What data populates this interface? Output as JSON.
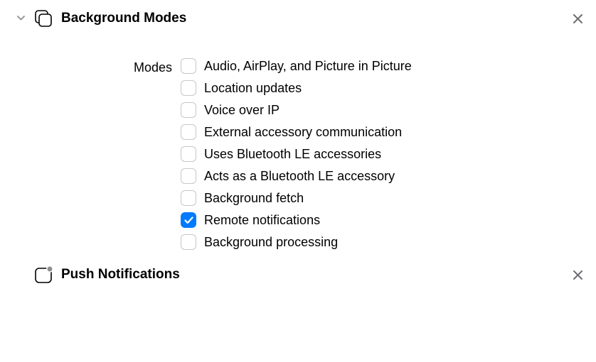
{
  "capabilities": [
    {
      "title": "Background Modes",
      "icon": "background-modes-icon",
      "expanded": true,
      "fields": {
        "label": "Modes",
        "options": [
          {
            "label": "Audio, AirPlay, and Picture in Picture",
            "checked": false
          },
          {
            "label": "Location updates",
            "checked": false
          },
          {
            "label": "Voice over IP",
            "checked": false
          },
          {
            "label": "External accessory communication",
            "checked": false
          },
          {
            "label": "Uses Bluetooth LE accessories",
            "checked": false
          },
          {
            "label": "Acts as a Bluetooth LE accessory",
            "checked": false
          },
          {
            "label": "Background fetch",
            "checked": false
          },
          {
            "label": "Remote notifications",
            "checked": true
          },
          {
            "label": "Background processing",
            "checked": false
          }
        ]
      }
    },
    {
      "title": "Push Notifications",
      "icon": "push-notifications-icon",
      "expanded": false
    }
  ],
  "colors": {
    "accent": "#007aff"
  }
}
